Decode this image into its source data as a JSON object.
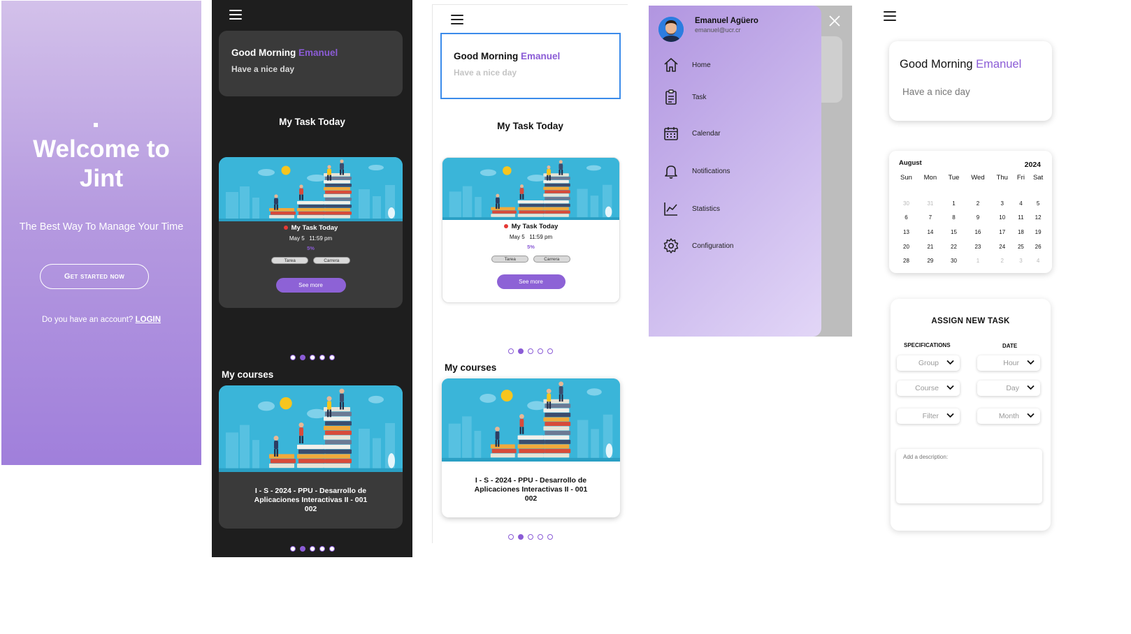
{
  "welcome": {
    "title": "Welcome to Jint",
    "tagline": "The Best Way To Manage Your Time",
    "cta_label": "Get started now",
    "account_prompt": "Do you have an account?",
    "login_label": "LOGIN"
  },
  "greeting": {
    "hello": "Good Morning",
    "name": "Emanuel",
    "subtitle": "Have a nice day"
  },
  "sections": {
    "task_today": "My Task Today",
    "courses": "My courses"
  },
  "task": {
    "title": "My Task Today",
    "date": "May 5",
    "time": "11:59 pm",
    "progress": "5%",
    "tags": [
      "Tarea",
      "Carrera"
    ],
    "see_more": "See more"
  },
  "carousel": {
    "count": 5,
    "active_index": 1
  },
  "course": {
    "line1": "I - S - 2024 - PPU - Desarrollo de",
    "line2": "Aplicaciones Interactivas II - 001",
    "line3": "002"
  },
  "drawer": {
    "user_name": "Emanuel Agüero",
    "user_email": "emanuel@ucr.cr",
    "items": [
      {
        "label": "Home",
        "icon": "home-icon"
      },
      {
        "label": "Task",
        "icon": "clipboard-icon"
      },
      {
        "label": "Calendar",
        "icon": "calendar-icon"
      },
      {
        "label": "Notifications",
        "icon": "bell-icon"
      },
      {
        "label": "Statistics",
        "icon": "chart-line-icon"
      },
      {
        "label": "Configuration",
        "icon": "gear-icon"
      }
    ]
  },
  "calendar": {
    "month": "August",
    "year": "2024",
    "weekdays": [
      "Sun",
      "Mon",
      "Tue",
      "Wed",
      "Thu",
      "Fri",
      "Sat"
    ],
    "weeks": [
      [
        "30",
        "31",
        "1",
        "2",
        "3",
        "4",
        "5"
      ],
      [
        "6",
        "7",
        "8",
        "9",
        "10",
        "11",
        "12"
      ],
      [
        "13",
        "14",
        "15",
        "16",
        "17",
        "18",
        "19"
      ],
      [
        "20",
        "21",
        "22",
        "23",
        "24",
        "25",
        "26"
      ],
      [
        "28",
        "29",
        "30",
        "1",
        "2",
        "3",
        "4"
      ]
    ],
    "muted": [
      [
        0,
        0
      ],
      [
        0,
        1
      ],
      [
        4,
        3
      ],
      [
        4,
        4
      ],
      [
        4,
        5
      ],
      [
        4,
        6
      ]
    ]
  },
  "assign": {
    "heading": "ASSIGN NEW TASK",
    "spec_label": "SPECIFICATIONS",
    "date_label": "DATE",
    "group": "Group",
    "course": "Course",
    "filter": "Filter",
    "hour": "Hour",
    "day": "Day",
    "month": "Month",
    "description_placeholder": "Add a description:"
  },
  "colors": {
    "accent": "#8b5cd6",
    "dark_bg": "#1e1e1e",
    "dark_card": "#3a3a3a",
    "illustration_bg": "#3ab5d9",
    "focus_border": "#3b8bea"
  }
}
